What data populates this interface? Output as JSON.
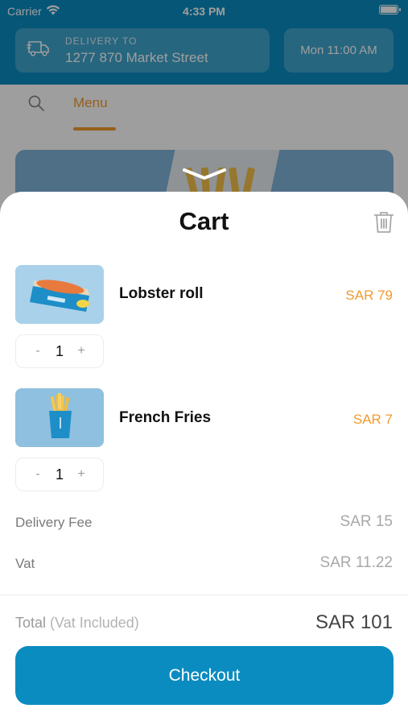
{
  "status_bar": {
    "carrier": "Carrier",
    "time": "4:33 PM"
  },
  "header": {
    "delivery_label": "DELIVERY TO",
    "delivery_address": "1277 870 Market Street",
    "delivery_time": "Mon 11:00 AM"
  },
  "tabs": {
    "menu_label": "Menu"
  },
  "cart": {
    "title": "Cart",
    "items": [
      {
        "name": "Lobster roll",
        "price": "SAR 79",
        "quantity": "1",
        "decrement": "-",
        "increment": "+"
      },
      {
        "name": "French Fries",
        "price": "SAR 7",
        "quantity": "1",
        "decrement": "-",
        "increment": "+"
      }
    ],
    "delivery_fee_label": "Delivery Fee",
    "delivery_fee_value": "SAR 15",
    "vat_label": "Vat",
    "vat_value": "SAR 11.22",
    "total_label": "Total",
    "total_sublabel": "(Vat Included)",
    "total_value": "SAR 101",
    "checkout_label": "Checkout"
  },
  "colors": {
    "brand_blue": "#0b8cc0",
    "accent_orange": "#f29a2e",
    "thumb_blue": "#a7d0e8"
  },
  "icons": [
    "wifi-icon",
    "battery-icon",
    "delivery-truck-icon",
    "search-icon",
    "chevron-down-icon",
    "trash-icon"
  ]
}
